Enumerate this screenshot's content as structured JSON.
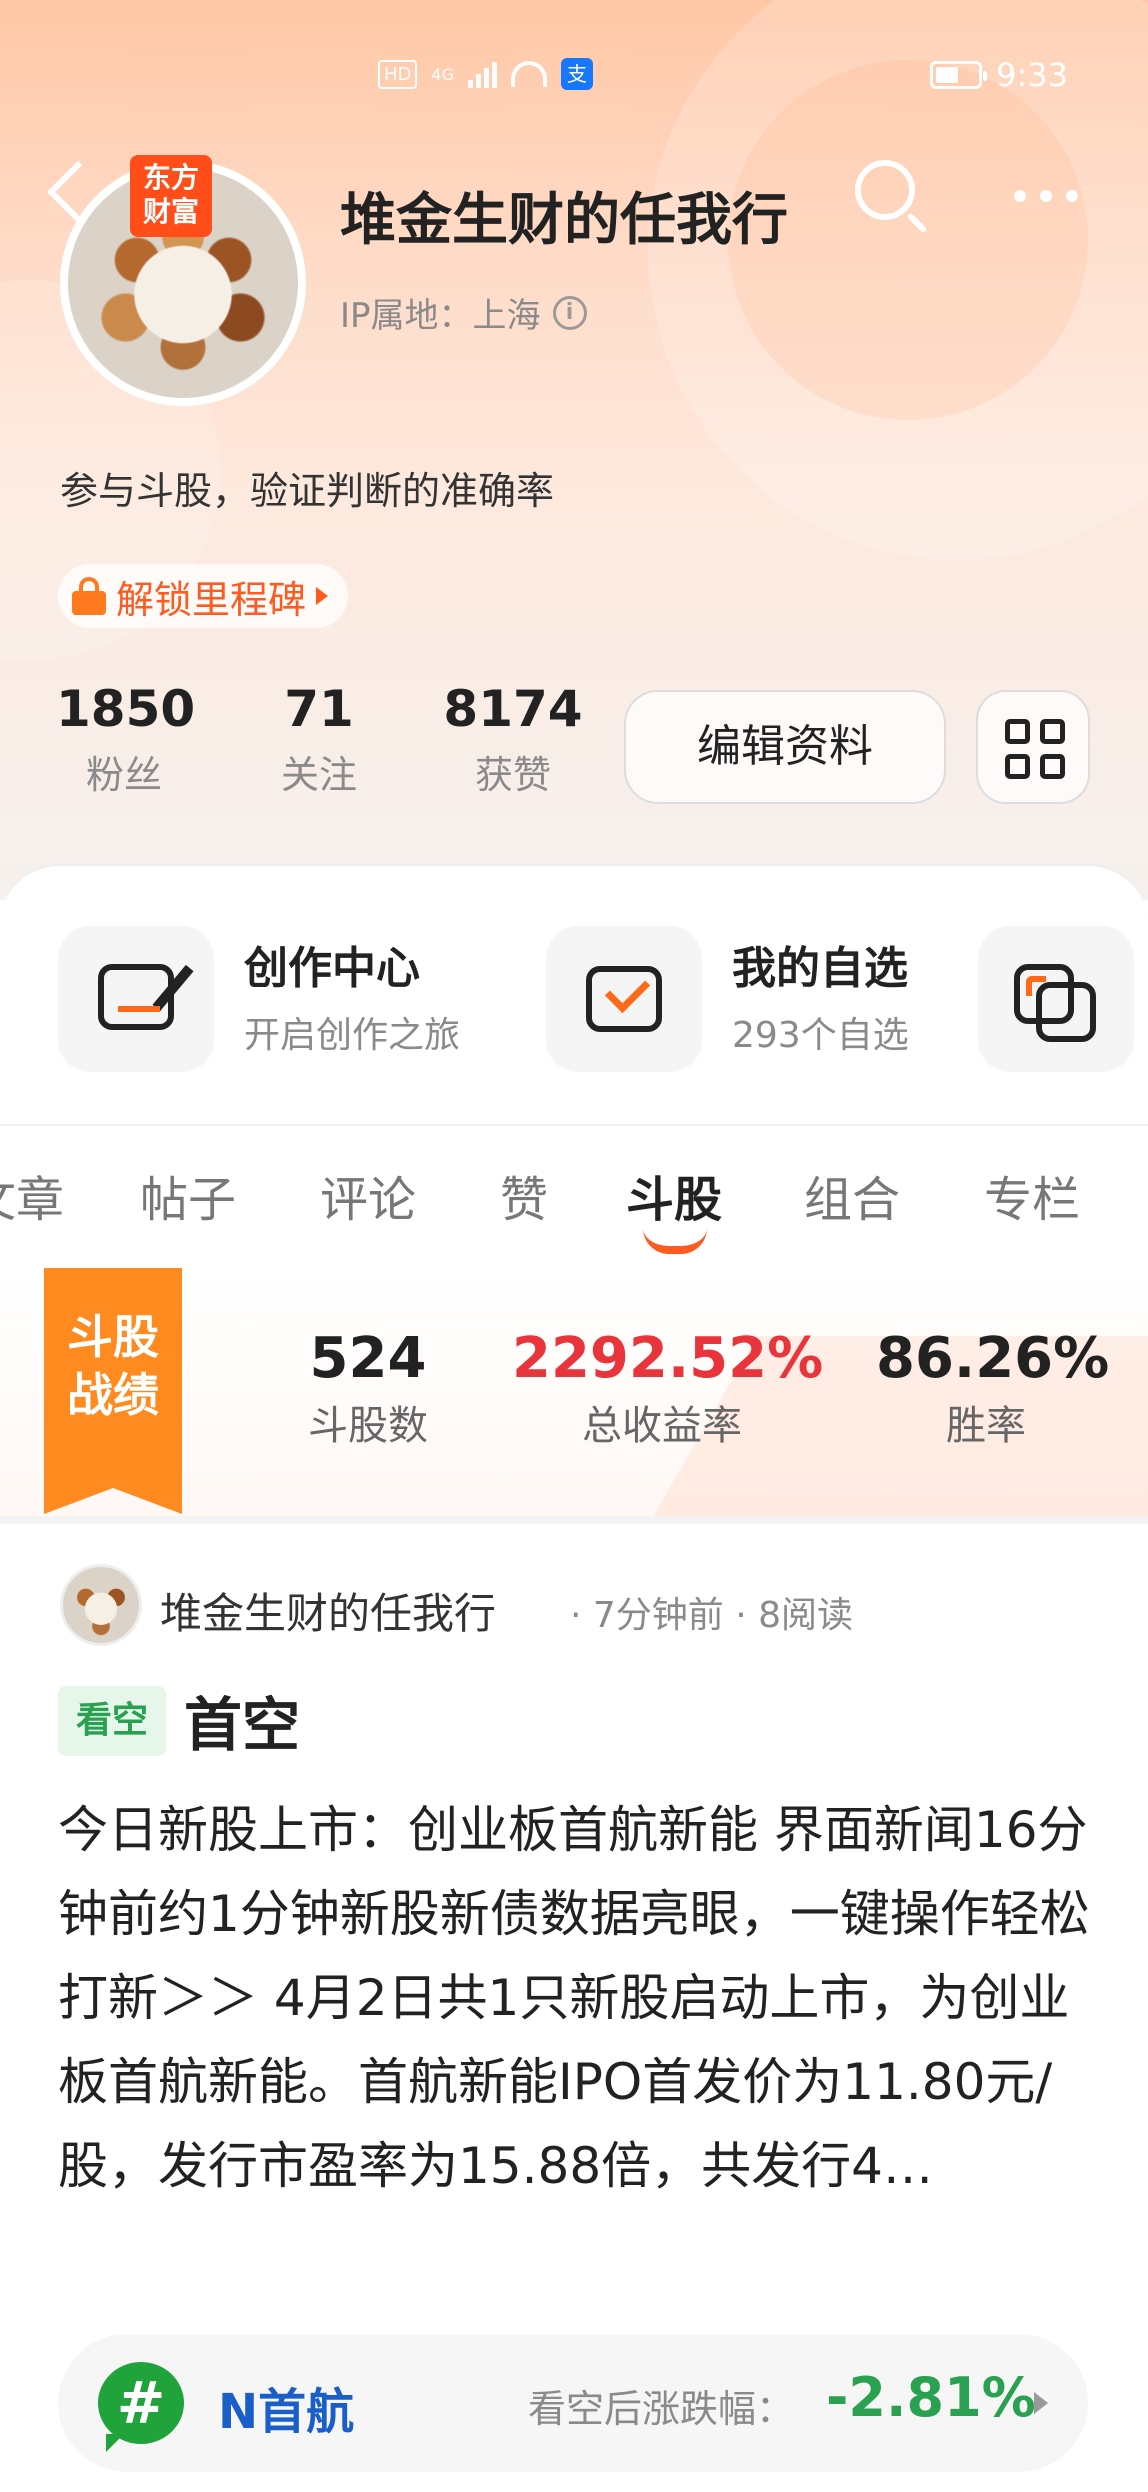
{
  "statusbar": {
    "hd": "HD",
    "network": "4G",
    "time": "9:33",
    "pay_icon": "支"
  },
  "profile": {
    "brand_badge": "东方\n财富",
    "username": "堆金生财的任我行",
    "ip_location": "IP属地：上海",
    "info_icon": "i",
    "bio": "参与斗股，验证判断的准确率",
    "milestone_label": "解锁里程碑"
  },
  "stats": [
    {
      "num": "1850",
      "label": "粉丝"
    },
    {
      "num": "71",
      "label": "关注"
    },
    {
      "num": "8174",
      "label": "获赞"
    }
  ],
  "buttons": {
    "edit_profile": "编辑资料"
  },
  "features": [
    {
      "title": "创作中心",
      "subtitle": "开启创作之旅"
    },
    {
      "title": "我的自选",
      "subtitle": "293个自选"
    }
  ],
  "tabs": [
    "文章",
    "帖子",
    "评论",
    "赞",
    "斗股",
    "组合",
    "专栏"
  ],
  "active_tab": "斗股",
  "battle": {
    "flag_label": "斗股\n战绩",
    "stats": [
      {
        "value": "524",
        "label": "斗股数"
      },
      {
        "value": "2292.52%",
        "label": "总收益率"
      },
      {
        "value": "86.26%",
        "label": "胜率"
      }
    ]
  },
  "post": {
    "author": "堆金生财的任我行",
    "meta": "· 7分钟前 · 8阅读",
    "tag": "看空",
    "title": "首空",
    "body": "今日新股上市：创业板首航新能 界面新闻16分钟前约1分钟新股新债数据亮眼，一键操作轻松打新＞＞ 4月2日共1只新股启动上市，为创业板首航新能。首航新能IPO首发价为11.80元/股，发行市盈率为15.88倍，共发行4…",
    "stock": {
      "icon": "#",
      "name": "N首航",
      "change_label": "看空后涨跌幅：",
      "change_value": "-2.81%"
    }
  },
  "colors": {
    "accent": "#ff5a1f",
    "red": "#e8343a",
    "green": "#2aa151",
    "blue": "#1a5fc9",
    "flag_orange": "#ff8a1f"
  }
}
